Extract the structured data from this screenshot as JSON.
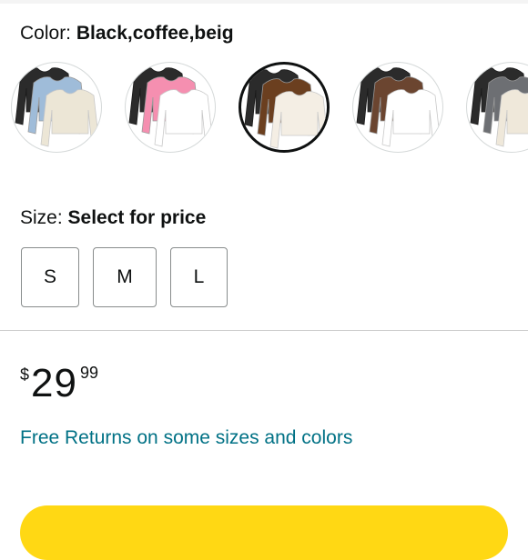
{
  "variation_color": {
    "label": "Color: ",
    "selected_value": "Black,coffee,beig",
    "swatches": [
      {
        "name": "black-blue-beige",
        "colors": [
          "#2b2b2b",
          "#9fbcd9",
          "#ece6d6"
        ],
        "selected": false
      },
      {
        "name": "black-pink-white",
        "colors": [
          "#2b2b2b",
          "#f58fb0",
          "#ffffff"
        ],
        "selected": false
      },
      {
        "name": "black-coffee-beige",
        "colors": [
          "#2b2b2b",
          "#6b3f1f",
          "#f4eee4"
        ],
        "selected": true
      },
      {
        "name": "black-brown-white",
        "colors": [
          "#2b2b2b",
          "#6b4530",
          "#ffffff"
        ],
        "selected": false
      },
      {
        "name": "black-gray-beige",
        "colors": [
          "#2b2b2b",
          "#6d6f73",
          "#efe8da"
        ],
        "selected": false
      }
    ]
  },
  "variation_size": {
    "label": "Size: ",
    "selected_value": "Select for price",
    "options": [
      "S",
      "M",
      "L"
    ]
  },
  "price": {
    "symbol": "$",
    "whole": "29",
    "fraction": "99"
  },
  "returns_link": "Free Returns on some sizes and colors",
  "colors": {
    "link": "#007185",
    "add_to_cart": "#ffd814",
    "selected_border": "#0f1111"
  }
}
